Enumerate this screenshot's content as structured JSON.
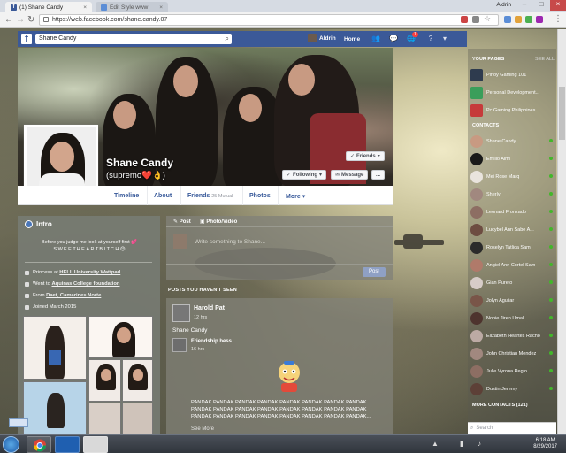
{
  "browser": {
    "tabs": [
      {
        "label": "(1) Shane Candy",
        "active": true
      },
      {
        "label": "Edit Style www",
        "active": false
      }
    ],
    "user": "Aldrin",
    "url": "https://web.facebook.com/shane.candy.07"
  },
  "fb_header": {
    "search_value": "Shane Candy",
    "user_name": "Aldrin",
    "home": "Home",
    "notification_count": "1"
  },
  "profile": {
    "name": "Shane Candy",
    "alt_name": "(supremo❤️👌)",
    "friends_btn": "Friends",
    "following_btn": "Following",
    "message_btn": "Message",
    "more_btn": "...",
    "tabs": [
      {
        "label": "Timeline"
      },
      {
        "label": "About"
      },
      {
        "label": "Friends",
        "count": "25 Mutual"
      },
      {
        "label": "Photos"
      },
      {
        "label": "More"
      }
    ]
  },
  "intro": {
    "heading": "Intro",
    "bio_line1": "Before you judge me look at yourself first 💕",
    "bio_line2": "S.W.E.E.T.H.E.A.R.T.B.I.T.C.H 😊",
    "rows": [
      {
        "prefix": "Princess at ",
        "link": "HELL University Wattpad"
      },
      {
        "prefix": "Went to ",
        "link": "Aquinas College foundation"
      },
      {
        "prefix": "From ",
        "link": "Daet, Camarines Norte"
      },
      {
        "prefix": "Joined March 2015",
        "link": ""
      }
    ]
  },
  "composer": {
    "tab_post": "Post",
    "tab_photo": "Photo/Video",
    "placeholder": "Write something to Shane...",
    "post_btn": "Post"
  },
  "feed": {
    "section_title": "POSTS YOU HAVEN'T SEEN",
    "post": {
      "author": "Harold Pat",
      "time": "12 hrs",
      "tagged": "Shane Candy",
      "shared_author": "Friendship.bess",
      "shared_time": "16 hrs",
      "text": "PANDAK PANDAK PANDAK PANDAK PANDAK PANDAK PANDAK PANDAK PANDAK PANDAK PANDAK PANDAK PANDAK PANDAK PANDAK PANDAK PANDAK PANDAK PANDAK PANDAK PANDAK PANDAK PANDAK PANDAK...",
      "see_more": "See More"
    }
  },
  "chat": {
    "pages_title": "YOUR PAGES",
    "see_all": "SEE ALL",
    "pages": [
      "Pinoy Gaming 101",
      "Personal Development...",
      "Pc Gaming Philippines"
    ],
    "contacts_title": "CONTACTS",
    "contacts": [
      "Shane Candy",
      "Emilio Almi",
      "Mei Rose Marq",
      "Sherly",
      "Leonard Fronzado",
      "Lucybel Ann Sabe A...",
      "Roselyn Tatlica Sam",
      "Angiel Ann Cortel Sam",
      "Gian Pureto",
      "Jolyn Aguilar",
      "Nonie Jireh Umali",
      "Elizabeth Heartes Racho",
      "John Christian Mendez",
      "Julie Vyrona Regio",
      "Dustin Jeremy"
    ],
    "more_title": "MORE CONTACTS (121)",
    "search_placeholder": "Search"
  },
  "taskbar": {
    "time": "6:18 AM",
    "date": "8/29/2017"
  },
  "colors": {
    "facebook_blue": "#3b5998",
    "online": "#42b72a"
  }
}
